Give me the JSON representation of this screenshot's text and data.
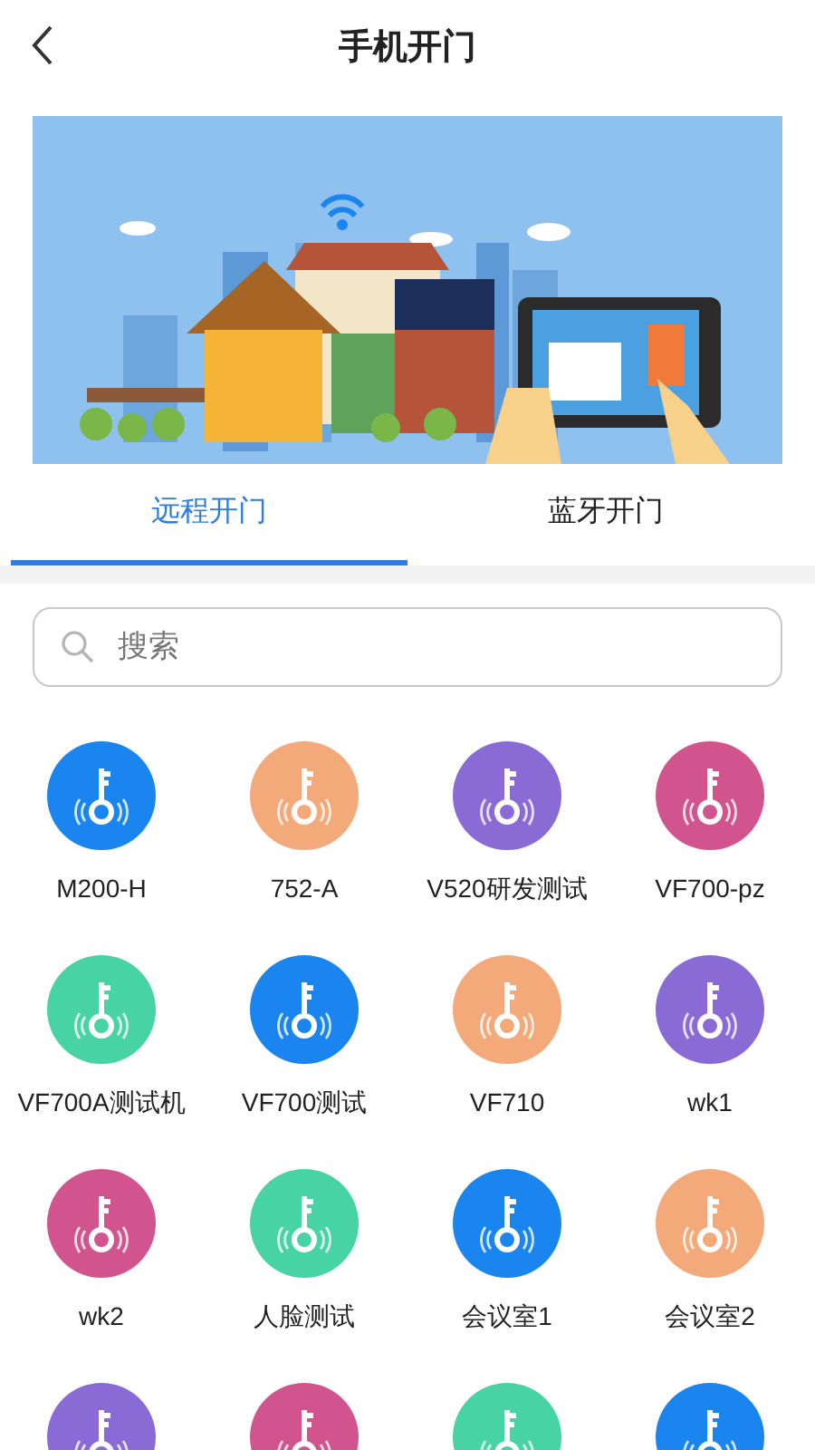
{
  "header": {
    "title": "手机开门"
  },
  "tabs": [
    {
      "label": "远程开门",
      "selected": true
    },
    {
      "label": "蓝牙开门",
      "selected": false
    }
  ],
  "search": {
    "placeholder": "搜索"
  },
  "doors": [
    {
      "label": "M200-H",
      "color": "#1a85ef"
    },
    {
      "label": "752-A",
      "color": "#f4a97a"
    },
    {
      "label": "V520研发测试",
      "color": "#8a6bd6"
    },
    {
      "label": "VF700-pz",
      "color": "#d2548e"
    },
    {
      "label": "VF700A测试机",
      "color": "#47d3a3"
    },
    {
      "label": "VF700测试",
      "color": "#1a85ef"
    },
    {
      "label": "VF710",
      "color": "#f4a97a"
    },
    {
      "label": "wk1",
      "color": "#8a6bd6"
    },
    {
      "label": "wk2",
      "color": "#d2548e"
    },
    {
      "label": "人脸测试",
      "color": "#47d3a3"
    },
    {
      "label": "会议室1",
      "color": "#1a85ef"
    },
    {
      "label": "会议室2",
      "color": "#f4a97a"
    },
    {
      "color": "#8a6bd6"
    },
    {
      "color": "#d2548e"
    },
    {
      "color": "#47d3a3"
    },
    {
      "color": "#1a85ef"
    }
  ]
}
